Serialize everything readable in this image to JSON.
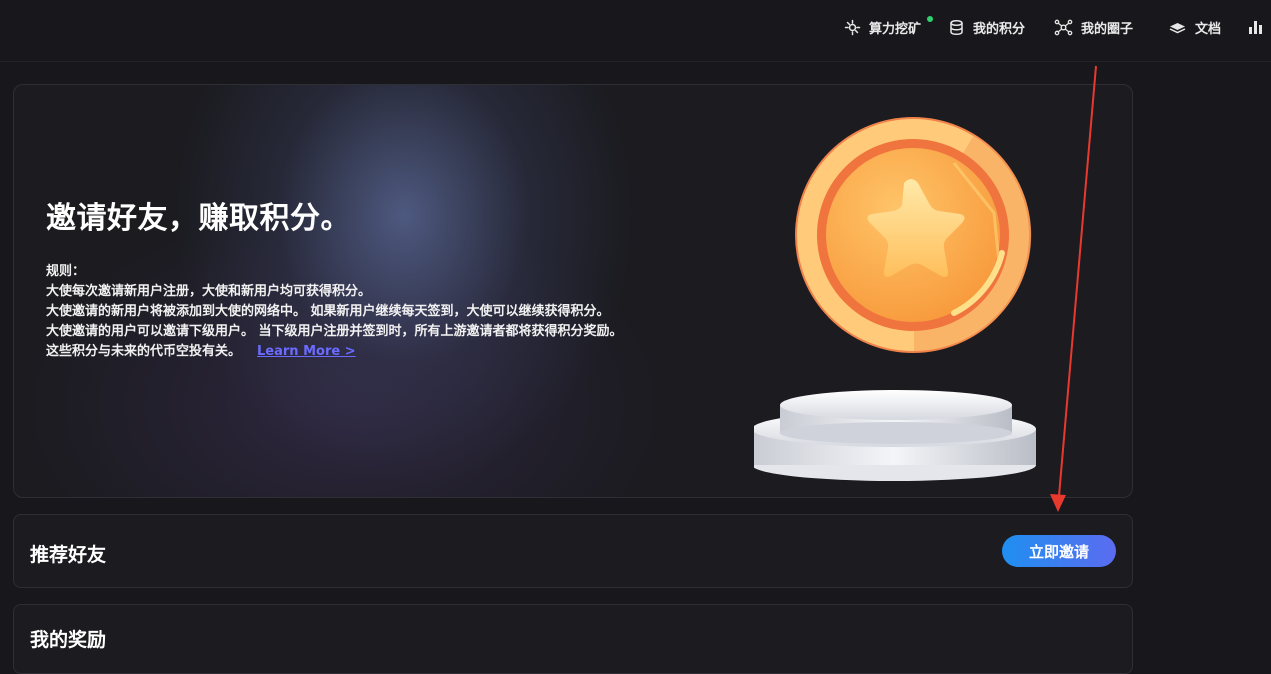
{
  "nav": {
    "mining": "算力挖矿",
    "points": "我的积分",
    "circle": "我的圈子",
    "docs": "文档"
  },
  "hero": {
    "title": "邀请好友，赚取积分。",
    "rules": [
      "规则：",
      "大使每次邀请新用户注册，大使和新用户均可获得积分。",
      "大使邀请的新用户将被添加到大使的网络中。 如果新用户继续每天签到，大使可以继续获得积分。",
      "大使邀请的用户可以邀请下级用户。 当下级用户注册并签到时，所有上游邀请者都将获得积分奖励。"
    ],
    "last_rule": "这些积分与未来的代币空投有关。",
    "learn_more": "Learn More >"
  },
  "referral": {
    "title": "推荐好友",
    "invite_button": "立即邀请"
  },
  "rewards": {
    "title": "我的奖励"
  },
  "colors": {
    "background": "#18181c",
    "accent": "#1f8ff0",
    "link": "#6b6bff",
    "annotation": "#e8392f"
  }
}
